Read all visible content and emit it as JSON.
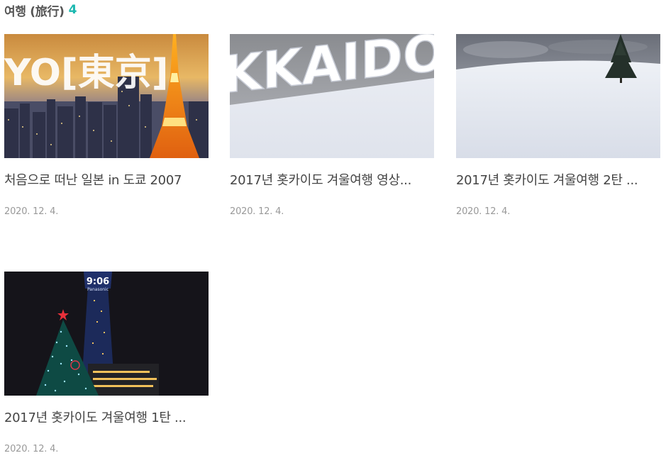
{
  "category": {
    "name": "여행 (旅行)",
    "count": "4"
  },
  "posts": [
    {
      "title": "처음으로 떠난 일본 in 도쿄 2007",
      "date": "2020. 12. 4.",
      "thumb_text": "YO[東京]",
      "thumb_icon": "tokyo-tower-photo"
    },
    {
      "title": "2017년 홋카이도 겨울여행 영상...",
      "date": "2020. 12. 4.",
      "thumb_text": "KKAIDO",
      "thumb_icon": "hokkaido-snow-sign-photo"
    },
    {
      "title": "2017년 홋카이도 겨울여행 2탄 ...",
      "date": "2020. 12. 4.",
      "thumb_icon": "snowy-tree-field-photo"
    },
    {
      "title": "2017년 홋카이도 겨울여행 1탄 ...",
      "date": "2020. 12. 4.",
      "thumb_text": "9:06",
      "thumb_subtext": "Panasonic",
      "thumb_icon": "sapporo-tv-tower-christmas-photo"
    }
  ],
  "colors": {
    "accent": "#1bb8b0",
    "title_text": "#444444",
    "date_text": "#999999"
  }
}
